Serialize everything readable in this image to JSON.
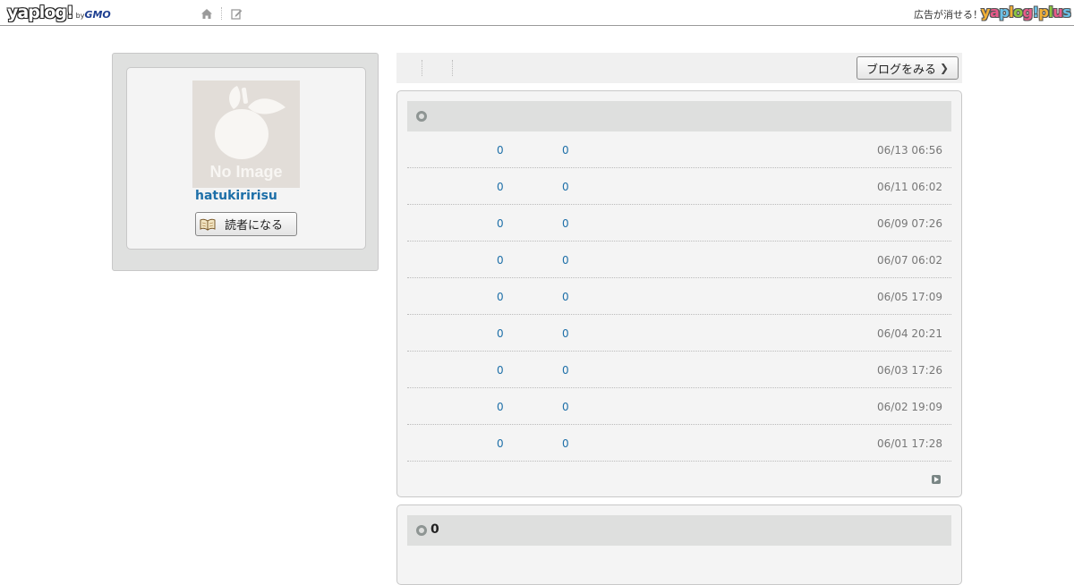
{
  "header": {
    "logo_text": "yaplog!",
    "logo_by": "by",
    "logo_company": "GMO",
    "nav_icons": [
      "home-icon",
      "edit-icon"
    ],
    "ad_text": "広告が消せる！",
    "plus_logo": "yaplog!plus"
  },
  "profile": {
    "avatar_placeholder": "No Image",
    "username": "hatukiririsu",
    "reader_button": "読者になる",
    "reader_icon": "book-icon"
  },
  "right_bar": {
    "view_blog_button": "ブログをみる"
  },
  "entries_panel": {
    "heading": "",
    "rows": [
      {
        "count_a": "0",
        "count_b": "0",
        "datetime": "06/13 06:56"
      },
      {
        "count_a": "0",
        "count_b": "0",
        "datetime": "06/11 06:02"
      },
      {
        "count_a": "0",
        "count_b": "0",
        "datetime": "06/09 07:26"
      },
      {
        "count_a": "0",
        "count_b": "0",
        "datetime": "06/07 06:02"
      },
      {
        "count_a": "0",
        "count_b": "0",
        "datetime": "06/05 17:09"
      },
      {
        "count_a": "0",
        "count_b": "0",
        "datetime": "06/04 20:21"
      },
      {
        "count_a": "0",
        "count_b": "0",
        "datetime": "06/03 17:26"
      },
      {
        "count_a": "0",
        "count_b": "0",
        "datetime": "06/02 19:09"
      },
      {
        "count_a": "0",
        "count_b": "0",
        "datetime": "06/01 17:28"
      }
    ]
  },
  "second_panel": {
    "heading": "0"
  },
  "colors": {
    "link": "#1d6fa8",
    "panel_header": "#dedfde",
    "panel_bg": "#f4f4f4"
  }
}
